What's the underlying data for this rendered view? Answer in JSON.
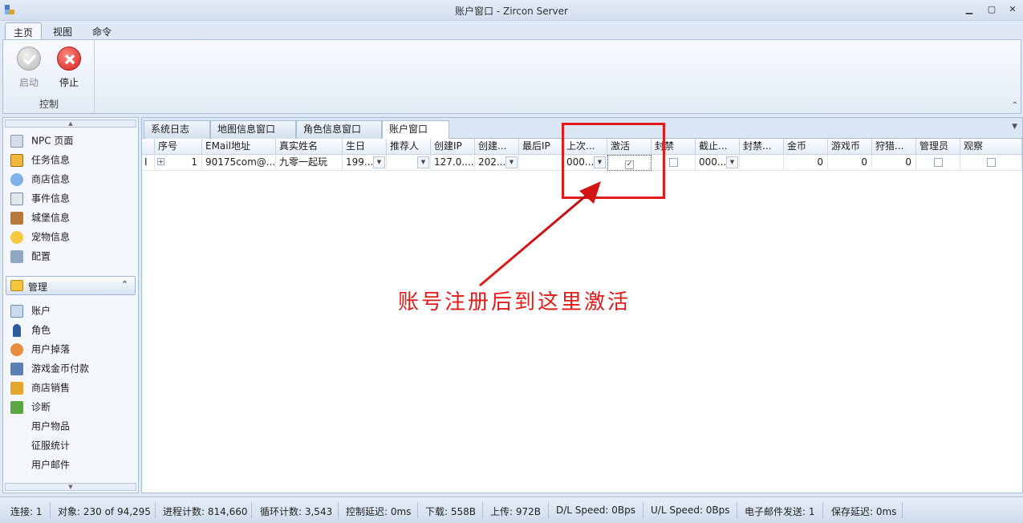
{
  "window": {
    "title": "账户窗口 - Zircon Server"
  },
  "ribbon": {
    "tabs": [
      "主页",
      "视图",
      "命令"
    ],
    "group_label": "控制",
    "start_label": "启动",
    "stop_label": "停止"
  },
  "nav": {
    "top_items": [
      "NPC 页面",
      "任务信息",
      "商店信息",
      "事件信息",
      "城堡信息",
      "宠物信息",
      "配置"
    ],
    "group_header": "管理",
    "manage_items": [
      "账户",
      "角色",
      "用户掉落",
      "游戏金币付款",
      "商店销售",
      "诊断",
      "用户物品",
      "征服统计",
      "用户邮件"
    ]
  },
  "doc_tabs": [
    "系统日志",
    "地图信息窗口",
    "角色信息窗口",
    "账户窗口"
  ],
  "grid": {
    "columns": [
      "序号",
      "EMail地址",
      "真实姓名",
      "生日",
      "推荐人",
      "创建IP",
      "创建...",
      "最后IP",
      "上次...",
      "激活",
      "封禁",
      "截止...",
      "封禁...",
      "金币",
      "游戏币",
      "狩猎...",
      "管理员",
      "观察"
    ],
    "row": {
      "indicator": "I",
      "index": "1",
      "email": "90175com@...",
      "real_name": "九零一起玩",
      "birthday": "199...",
      "referrer": "",
      "create_ip": "127.0....",
      "create_date": "202...",
      "last_ip": "",
      "last_date": "000...",
      "activated": true,
      "banned": false,
      "ban_until": "000...",
      "ban_reason": "",
      "gold": "0",
      "game_gold": "0",
      "hunt_gold": "0",
      "admin": false,
      "observer": false
    }
  },
  "annotation": {
    "text": "账号注册后到这里激活",
    "color": "#e31b1b"
  },
  "status": {
    "connections": "连接: 1",
    "objects": "对象: 230 of 94,295",
    "process_count": "进程计数: 814,660",
    "loop_count": "循环计数: 3,543",
    "control_delay": "控制延迟: 0ms",
    "download": "下载: 558B",
    "upload": "上传: 972B",
    "dl_speed": "D/L Speed: 0Bps",
    "ul_speed": "U/L Speed: 0Bps",
    "email_sent": "电子邮件发送: 1",
    "save_delay": "保存延迟: 0ms"
  }
}
